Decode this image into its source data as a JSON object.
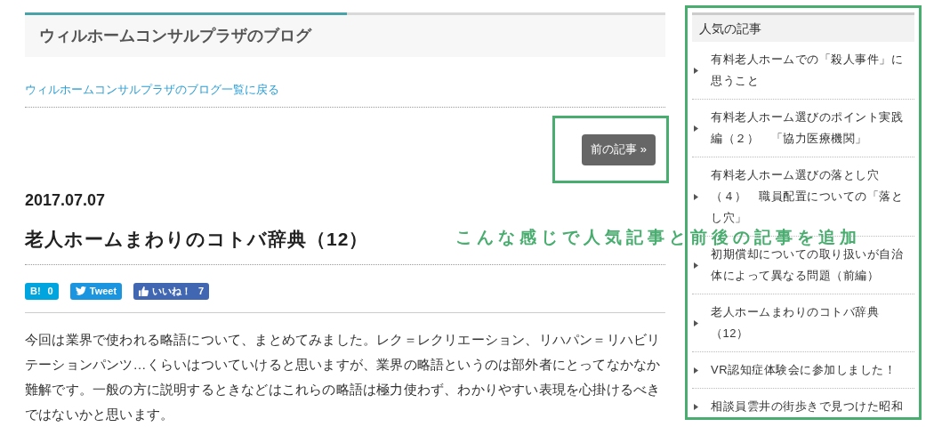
{
  "blog_title": "ウィルホームコンサルプラザのブログ",
  "back_link": "ウィルホームコンサルプラザのブログ一覧に戻る",
  "prev_button": "前の記事 »",
  "date": "2017.07.07",
  "post_title": "老人ホームまわりのコトバ辞典（12）",
  "share_buttons": [
    {
      "kind": "hatena",
      "label": "B!",
      "count": "0"
    },
    {
      "kind": "tweet",
      "label": "Tweet"
    },
    {
      "kind": "like",
      "label": "いいね！",
      "count": "7"
    }
  ],
  "body": "今回は業界で使われる略語について、まとめてみました。レク＝レクリエーション、リハパン＝リハビリテーションパンツ…くらいはついていけると思いますが、業界の略語というのは部外者にとってなかなか難解です。一般の方に説明するときなどはこれらの略語は極力使わず、わかりやすい表現を心掛けるべきではないかと思います。",
  "sidebar": {
    "title": "人気の記事",
    "items": [
      {
        "label": "有料老人ホームでの「殺人事件」に思うこと"
      },
      {
        "label": "有料老人ホーム選びのポイント実践編（２）　「協力医療機関」"
      },
      {
        "label": "有料老人ホーム選びの落とし穴（４）　職員配置についての「落とし穴」"
      },
      {
        "label": "初期償却についての取り扱いが自治体によって異なる問題（前編）"
      },
      {
        "label": "老人ホームまわりのコトバ辞典（12）"
      },
      {
        "label": "VR認知症体験会に参加しました！"
      },
      {
        "label": "相談員雲井の街歩きで見つけた昭和"
      }
    ]
  },
  "annotation": "こんな感じで人気記事と前後の記事を追加"
}
